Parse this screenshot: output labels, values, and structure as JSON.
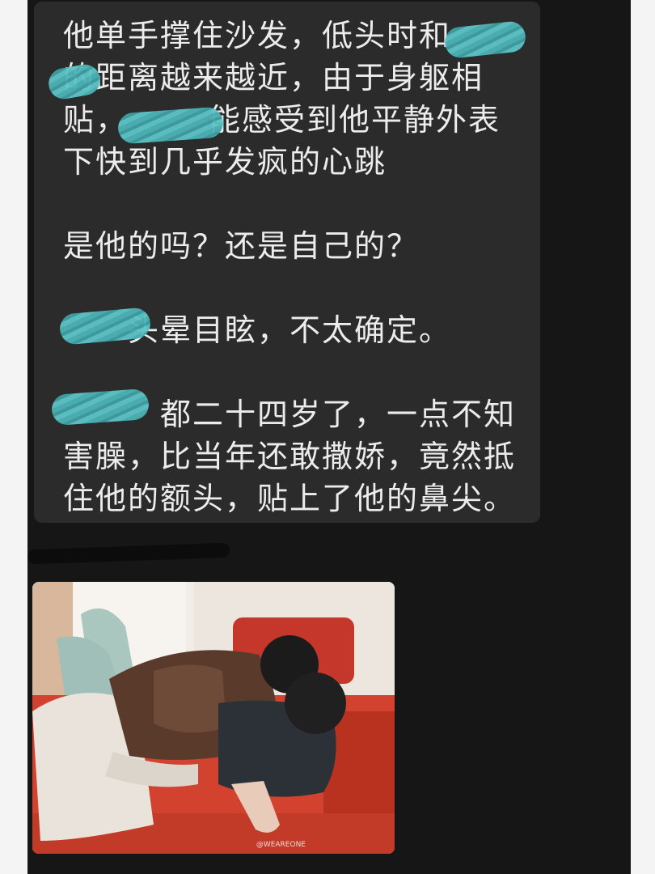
{
  "message": {
    "paragraphs": [
      "他单手撑住沙发，低头时和\n的距离越来越近，由于身躯相\n贴，　　　能感受到他平静外表\n下快到几乎发疯的心跳",
      "是他的吗？还是自己的？",
      "　　头晕目眩，不太确定。",
      "　　　都二十四岁了，一点不知\n害臊，比当年还敢撒娇，竟然抵\n住他的额头，贴上了他的鼻尖。"
    ]
  },
  "colors": {
    "background": "#141414",
    "bubble": "#2b2b2b",
    "text": "#ececec",
    "redaction": "#4cb3b6"
  },
  "photo": {
    "watermark": "@WEAREONE"
  }
}
